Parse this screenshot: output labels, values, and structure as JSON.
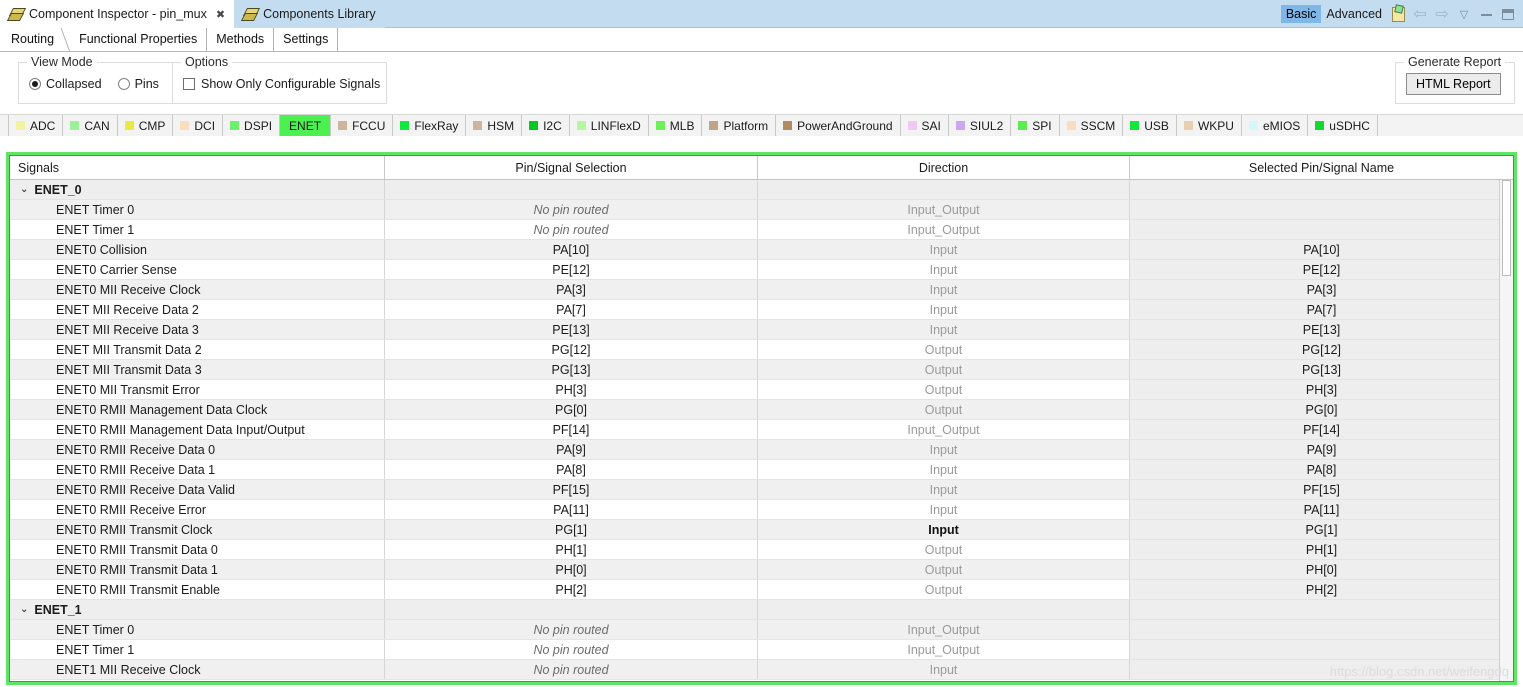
{
  "titlebar": {
    "tabs": [
      {
        "label": "Component Inspector - pin_mux",
        "active": true,
        "closable": true,
        "icon": "components-diamond-icon"
      },
      {
        "label": "Components Library",
        "active": false,
        "closable": false,
        "icon": "components-diamond-icon"
      }
    ],
    "modes": [
      {
        "label": "Basic",
        "selected": true
      },
      {
        "label": "Advanced",
        "selected": false
      }
    ],
    "icons": [
      "note-icon",
      "arrow-left-icon",
      "arrow-right-icon",
      "chevron-down-icon",
      "minimize-icon",
      "maximize-icon"
    ]
  },
  "view_tabs": [
    {
      "label": "Routing",
      "active": true
    },
    {
      "label": "Functional Properties",
      "active": false
    },
    {
      "label": "Methods",
      "active": false
    },
    {
      "label": "Settings",
      "active": false
    }
  ],
  "view_mode": {
    "title": "View Mode",
    "options": [
      {
        "label": "Collapsed",
        "selected": true
      },
      {
        "label": "Pins",
        "selected": false
      }
    ]
  },
  "options": {
    "title": "Options",
    "checkbox": {
      "label": "Show Only Configurable Signals",
      "checked": false
    }
  },
  "report": {
    "title": "Generate Report",
    "button_label": "HTML Report"
  },
  "peripheral_tabs": [
    {
      "label": "ADC",
      "color": "#f2f2a0",
      "active": false
    },
    {
      "label": "CAN",
      "color": "#9cf09c",
      "active": false
    },
    {
      "label": "CMP",
      "color": "#ece83f",
      "active": false
    },
    {
      "label": "DCI",
      "color": "#fadcc0",
      "active": false
    },
    {
      "label": "DSPI",
      "color": "#6ef06e",
      "active": false
    },
    {
      "label": "ENET",
      "color": "#4cf050",
      "active": true
    },
    {
      "label": "FCCU",
      "color": "#cdb49c",
      "active": false
    },
    {
      "label": "FlexRay",
      "color": "#12e83c",
      "active": false
    },
    {
      "label": "HSM",
      "color": "#cdb49c",
      "active": false
    },
    {
      "label": "I2C",
      "color": "#00c81e",
      "active": false
    },
    {
      "label": "LINFlexD",
      "color": "#b4f7a0",
      "active": false
    },
    {
      "label": "MLB",
      "color": "#6ef05a",
      "active": false
    },
    {
      "label": "Platform",
      "color": "#bfa488",
      "active": false
    },
    {
      "label": "PowerAndGround",
      "color": "#b08c64",
      "active": false
    },
    {
      "label": "SAI",
      "color": "#f0c8f0",
      "active": false
    },
    {
      "label": "SIUL2",
      "color": "#caa8f0",
      "active": false
    },
    {
      "label": "SPI",
      "color": "#5cec50",
      "active": false
    },
    {
      "label": "SSCM",
      "color": "#fadcc0",
      "active": false
    },
    {
      "label": "USB",
      "color": "#14e63c",
      "active": false
    },
    {
      "label": "WKPU",
      "color": "#e8cfae",
      "active": false
    },
    {
      "label": "eMIOS",
      "color": "#d4f7f7",
      "active": false
    },
    {
      "label": "uSDHC",
      "color": "#14d832",
      "active": false
    }
  ],
  "table": {
    "columns": [
      "Signals",
      "Pin/Signal Selection",
      "Direction",
      "Selected Pin/Signal Name"
    ],
    "rows": [
      {
        "type": "group",
        "signal": "ENET_0",
        "expanded": true,
        "pin": "",
        "direction": "",
        "selected": ""
      },
      {
        "type": "signal",
        "signal": "ENET Timer 0",
        "pin": "No pin routed",
        "pin_italic": true,
        "direction": "Input_Output",
        "selected": ""
      },
      {
        "type": "signal",
        "signal": "ENET Timer 1",
        "pin": "No pin routed",
        "pin_italic": true,
        "direction": "Input_Output",
        "selected": ""
      },
      {
        "type": "signal",
        "signal": "ENET0 Collision",
        "pin": "PA[10]",
        "direction": "Input",
        "selected": "PA[10]"
      },
      {
        "type": "signal",
        "signal": "ENET0 Carrier Sense",
        "pin": "PE[12]",
        "direction": "Input",
        "selected": "PE[12]"
      },
      {
        "type": "signal",
        "signal": "ENET0 MII Receive Clock",
        "pin": "PA[3]",
        "direction": "Input",
        "selected": "PA[3]"
      },
      {
        "type": "signal",
        "signal": "ENET MII Receive Data 2",
        "pin": "PA[7]",
        "direction": "Input",
        "selected": "PA[7]"
      },
      {
        "type": "signal",
        "signal": "ENET MII Receive Data 3",
        "pin": "PE[13]",
        "direction": "Input",
        "selected": "PE[13]"
      },
      {
        "type": "signal",
        "signal": "ENET MII Transmit Data 2",
        "pin": "PG[12]",
        "direction": "Output",
        "selected": "PG[12]"
      },
      {
        "type": "signal",
        "signal": "ENET MII Transmit Data 3",
        "pin": "PG[13]",
        "direction": "Output",
        "selected": "PG[13]"
      },
      {
        "type": "signal",
        "signal": "ENET0 MII Transmit Error",
        "pin": "PH[3]",
        "direction": "Output",
        "selected": "PH[3]"
      },
      {
        "type": "signal",
        "signal": "ENET0 RMII Management Data Clock",
        "pin": "PG[0]",
        "direction": "Output",
        "selected": "PG[0]"
      },
      {
        "type": "signal",
        "signal": "ENET0 RMII Management Data Input/Output",
        "pin": "PF[14]",
        "direction": "Input_Output",
        "selected": "PF[14]"
      },
      {
        "type": "signal",
        "signal": "ENET0 RMII Receive Data 0",
        "pin": "PA[9]",
        "direction": "Input",
        "selected": "PA[9]"
      },
      {
        "type": "signal",
        "signal": "ENET0 RMII Receive Data 1",
        "pin": "PA[8]",
        "direction": "Input",
        "selected": "PA[8]"
      },
      {
        "type": "signal",
        "signal": "ENET0 RMII Receive Data Valid",
        "pin": "PF[15]",
        "direction": "Input",
        "selected": "PF[15]"
      },
      {
        "type": "signal",
        "signal": "ENET0 RMII Receive Error",
        "pin": "PA[11]",
        "direction": "Input",
        "selected": "PA[11]"
      },
      {
        "type": "signal",
        "signal": "ENET0 RMII Transmit Clock",
        "pin": "PG[1]",
        "direction": "Input",
        "direction_strong": true,
        "selected": "PG[1]"
      },
      {
        "type": "signal",
        "signal": "ENET0 RMII Transmit Data 0",
        "pin": "PH[1]",
        "direction": "Output",
        "selected": "PH[1]"
      },
      {
        "type": "signal",
        "signal": "ENET0 RMII Transmit Data 1",
        "pin": "PH[0]",
        "direction": "Output",
        "selected": "PH[0]"
      },
      {
        "type": "signal",
        "signal": "ENET0 RMII Transmit Enable",
        "pin": "PH[2]",
        "direction": "Output",
        "selected": "PH[2]"
      },
      {
        "type": "group",
        "signal": "ENET_1",
        "expanded": true,
        "pin": "",
        "direction": "",
        "selected": ""
      },
      {
        "type": "signal",
        "signal": "ENET Timer 0",
        "pin": "No pin routed",
        "pin_italic": true,
        "direction": "Input_Output",
        "selected": ""
      },
      {
        "type": "signal",
        "signal": "ENET Timer 1",
        "pin": "No pin routed",
        "pin_italic": true,
        "direction": "Input_Output",
        "selected": ""
      },
      {
        "type": "signal",
        "signal": "ENET1 MII Receive Clock",
        "pin": "No pin routed",
        "pin_italic": true,
        "direction": "Input",
        "selected": ""
      }
    ]
  },
  "watermark": "https://blog.csdn.net/weifengdq",
  "colors": {
    "frame_green": "#5de563",
    "active_tab_green": "#4cf050",
    "editor_tab_blue": "#c3dcf0",
    "mode_selected_blue": "#7fb7e8"
  }
}
